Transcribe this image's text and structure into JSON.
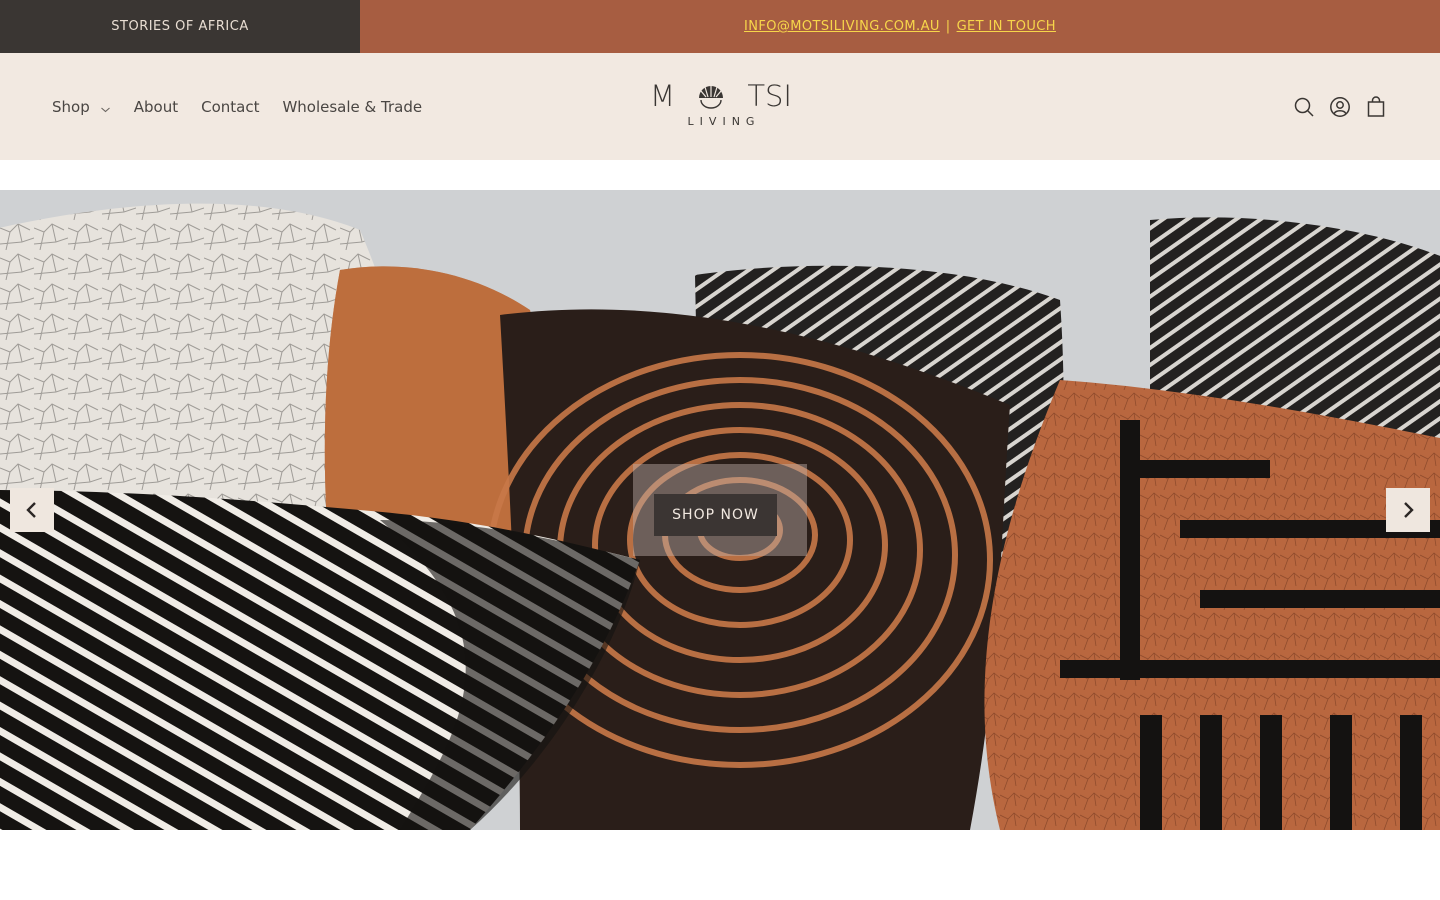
{
  "announcement": {
    "left_text": "STORIES OF AFRICA",
    "email_link": "INFO@MOTSILIVING.COM.AU",
    "separator": "|",
    "contact_link": "GET IN TOUCH"
  },
  "header": {
    "nav": [
      {
        "label": "Shop"
      },
      {
        "label": "About"
      },
      {
        "label": "Contact"
      },
      {
        "label": "Wholesale & Trade"
      }
    ],
    "logo": {
      "word_left": "M",
      "word_right": "TSI",
      "sub": "LIVING"
    },
    "icons": [
      "search-icon",
      "account-icon",
      "cart-icon"
    ]
  },
  "hero": {
    "cta_label": "SHOP NOW",
    "controls": [
      "chevron-left-icon",
      "chevron-right-icon"
    ]
  },
  "colors": {
    "announce_dark": "#3a3633",
    "announce_accent": "#a75d41",
    "link_yellow": "#f7d64a",
    "header_bg": "#f2e9e1",
    "button_dark": "#3b3533"
  }
}
